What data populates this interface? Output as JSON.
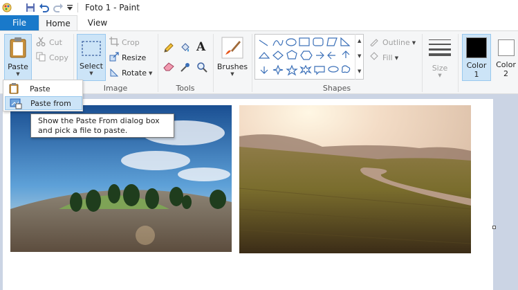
{
  "window": {
    "title": "Foto 1 - Paint"
  },
  "tabs": {
    "file": "File",
    "home": "Home",
    "view": "View"
  },
  "clipboard": {
    "paste": "Paste",
    "cut": "Cut",
    "copy": "Copy"
  },
  "image": {
    "select": "Select",
    "crop": "Crop",
    "resize": "Resize",
    "rotate": "Rotate",
    "group_label": "Image"
  },
  "tools": {
    "group_label": "Tools"
  },
  "brushes": {
    "label": "Brushes"
  },
  "shapes": {
    "outline": "Outline",
    "fill": "Fill",
    "group_label": "Shapes"
  },
  "size": {
    "label": "Size"
  },
  "colors": {
    "color1_line1": "Color",
    "color1_line2": "1",
    "color2_line1": "Color",
    "color2_line2": "2",
    "color1_value": "#000000",
    "color2_value": "#ffffff"
  },
  "paste_menu": {
    "item1": "Paste",
    "item2": "Paste from"
  },
  "tooltip": {
    "line1": "Show the Paste From dialog box",
    "line2": "and pick a file to paste."
  },
  "accent": "#1979ca"
}
